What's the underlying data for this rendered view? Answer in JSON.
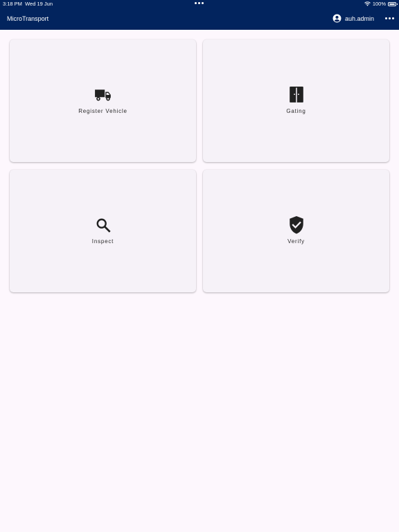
{
  "status_bar": {
    "time": "3:18 PM",
    "date": "Wed 19 Jun",
    "battery": "100%"
  },
  "header": {
    "title": "MicroTransport",
    "user": "auh.admin"
  },
  "tiles": [
    {
      "label": "Register Vehicle",
      "icon": "truck-icon"
    },
    {
      "label": "Gating",
      "icon": "door-icon"
    },
    {
      "label": "Inspect",
      "icon": "search-icon"
    },
    {
      "label": "Verify",
      "icon": "shield-check-icon"
    }
  ],
  "colors": {
    "header_bg": "#02245e",
    "page_bg": "#fdf7fd",
    "tile_bg": "#f6f2f8",
    "icon": "#222222"
  }
}
